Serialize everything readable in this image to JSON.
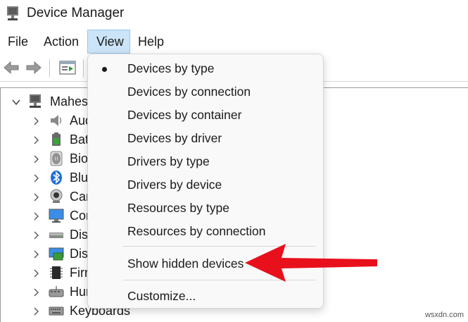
{
  "window": {
    "title": "Device Manager",
    "icon": "device-manager-icon"
  },
  "menubar": {
    "items": [
      "File",
      "Action",
      "View",
      "Help"
    ],
    "active": "View"
  },
  "toolbar": {
    "buttons": [
      "back-arrow-icon",
      "forward-arrow-icon",
      "properties-icon"
    ]
  },
  "tree": {
    "root": {
      "label": "Mahes",
      "icon": "computer-icon"
    },
    "nodes": [
      {
        "label": "Aud",
        "icon": "speaker-icon"
      },
      {
        "label": "Bat",
        "icon": "battery-icon"
      },
      {
        "label": "Bio",
        "icon": "fingerprint-icon"
      },
      {
        "label": "Blu",
        "icon": "bluetooth-icon"
      },
      {
        "label": "Car",
        "icon": "webcam-icon"
      },
      {
        "label": "Cor",
        "icon": "monitor-icon"
      },
      {
        "label": "Dis",
        "icon": "disk-drive-icon"
      },
      {
        "label": "Dis",
        "icon": "display-adapter-icon"
      },
      {
        "label": "Firr",
        "icon": "firmware-chip-icon"
      },
      {
        "label": "Hur",
        "icon": "hid-icon"
      },
      {
        "label": "Keyboards",
        "icon": "keyboard-icon"
      }
    ]
  },
  "view_menu": {
    "items": [
      {
        "label": "Devices by type",
        "checked": true
      },
      {
        "label": "Devices by connection",
        "checked": false
      },
      {
        "label": "Devices by container",
        "checked": false
      },
      {
        "label": "Devices by driver",
        "checked": false
      },
      {
        "label": "Drivers by type",
        "checked": false
      },
      {
        "label": "Drivers by device",
        "checked": false
      },
      {
        "label": "Resources by type",
        "checked": false
      },
      {
        "label": "Resources by connection",
        "checked": false
      },
      {
        "label": "Show hidden devices",
        "checked": false
      },
      {
        "label": "Customize...",
        "checked": false
      }
    ]
  },
  "annotation": {
    "arrow_color": "#e8101a",
    "points_to": "Show hidden devices"
  },
  "watermark": "wsxdn.com"
}
